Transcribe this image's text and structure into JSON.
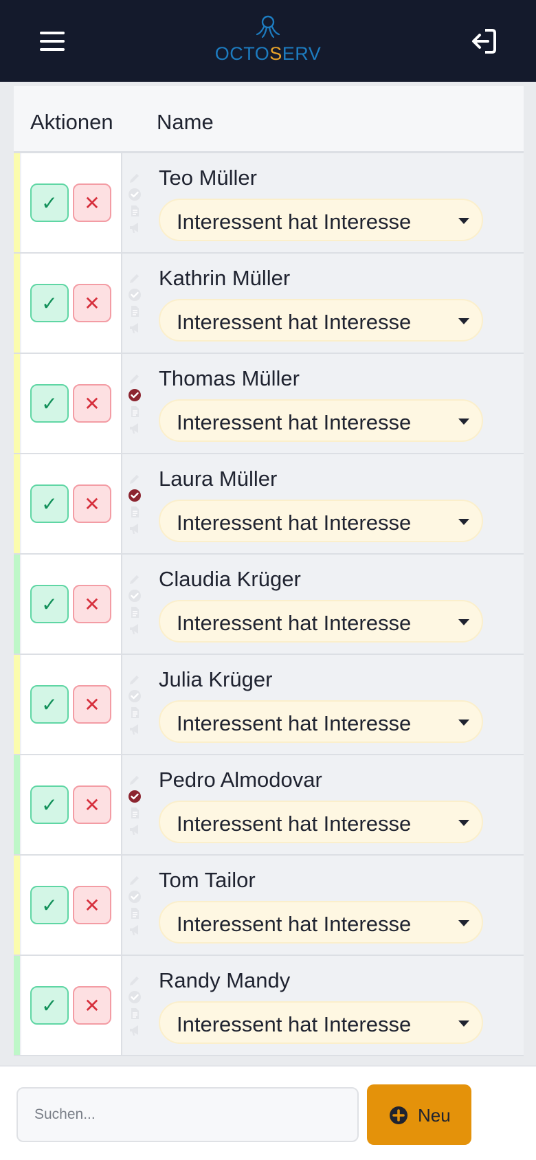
{
  "header": {
    "logo_part1": "OCTO",
    "logo_part2": "S",
    "logo_part3": "ERV"
  },
  "table": {
    "col_actions": "Aktionen",
    "col_name": "Name"
  },
  "actions": {
    "confirm_symbol": "✓",
    "reject_symbol": "✕"
  },
  "colors": {
    "stripe_yellow": "#fbfcae",
    "stripe_green": "#bef7c8",
    "check_active": "#8c2530",
    "icon_inactive": "#e2e4e8"
  },
  "rows": [
    {
      "name": "Teo Müller",
      "status": "Interessent hat Interesse",
      "stripe": "yellow",
      "checked": false
    },
    {
      "name": "Kathrin Müller",
      "status": "Interessent hat Interesse",
      "stripe": "yellow",
      "checked": false
    },
    {
      "name": "Thomas Müller",
      "status": "Interessent hat Interesse",
      "stripe": "yellow",
      "checked": true
    },
    {
      "name": "Laura Müller",
      "status": "Interessent hat Interesse",
      "stripe": "yellow",
      "checked": true
    },
    {
      "name": "Claudia Krüger",
      "status": "Interessent hat Interesse",
      "stripe": "green",
      "checked": false
    },
    {
      "name": "Julia Krüger",
      "status": "Interessent hat Interesse",
      "stripe": "yellow",
      "checked": false
    },
    {
      "name": "Pedro Almodovar",
      "status": "Interessent hat Interesse",
      "stripe": "green",
      "checked": true
    },
    {
      "name": "Tom Tailor",
      "status": "Interessent hat Interesse",
      "stripe": "yellow",
      "checked": false
    },
    {
      "name": "Randy Mandy",
      "status": "Interessent hat Interesse",
      "stripe": "green",
      "checked": false
    }
  ],
  "footer": {
    "search_placeholder": "Suchen...",
    "new_label": "Neu"
  }
}
